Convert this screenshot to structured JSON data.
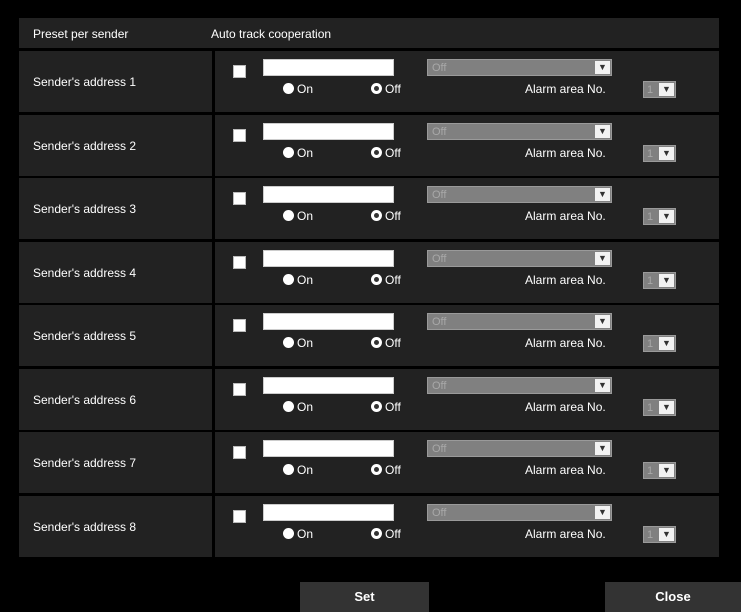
{
  "header": {
    "left": "Preset per sender",
    "right": "Auto track cooperation"
  },
  "rows": [
    {
      "label": "Sender's address 1",
      "on": "On",
      "off": "Off",
      "preset": "Off",
      "alarm_label": "Alarm area No.",
      "alarm_value": "1"
    },
    {
      "label": "Sender's address 2",
      "on": "On",
      "off": "Off",
      "preset": "Off",
      "alarm_label": "Alarm area No.",
      "alarm_value": "1"
    },
    {
      "label": "Sender's address 3",
      "on": "On",
      "off": "Off",
      "preset": "Off",
      "alarm_label": "Alarm area No.",
      "alarm_value": "1"
    },
    {
      "label": "Sender's address 4",
      "on": "On",
      "off": "Off",
      "preset": "Off",
      "alarm_label": "Alarm area No.",
      "alarm_value": "1"
    },
    {
      "label": "Sender's address 5",
      "on": "On",
      "off": "Off",
      "preset": "Off",
      "alarm_label": "Alarm area No.",
      "alarm_value": "1"
    },
    {
      "label": "Sender's address 6",
      "on": "On",
      "off": "Off",
      "preset": "Off",
      "alarm_label": "Alarm area No.",
      "alarm_value": "1"
    },
    {
      "label": "Sender's address 7",
      "on": "On",
      "off": "Off",
      "preset": "Off",
      "alarm_label": "Alarm area No.",
      "alarm_value": "1"
    },
    {
      "label": "Sender's address 8",
      "on": "On",
      "off": "Off",
      "preset": "Off",
      "alarm_label": "Alarm area No.",
      "alarm_value": "1"
    }
  ],
  "buttons": {
    "set": "Set",
    "close": "Close"
  },
  "icons": {
    "dropdown": "chevron-down-icon"
  }
}
